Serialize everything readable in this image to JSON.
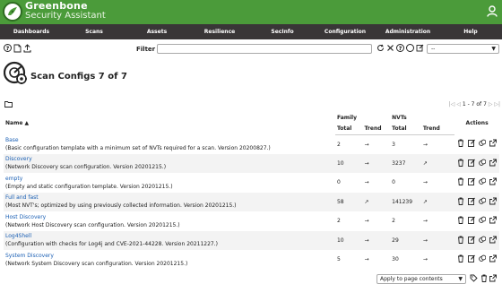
{
  "brand": {
    "line1": "Greenbone",
    "line2": "Security Assistant"
  },
  "nav": [
    "Dashboards",
    "Scans",
    "Assets",
    "Resilience",
    "SecInfo",
    "Configuration",
    "Administration",
    "Help"
  ],
  "filter": {
    "label": "Filter",
    "value": "",
    "select_value": "--"
  },
  "page": {
    "title": "Scan Configs 7 of 7"
  },
  "pager": {
    "text": "1 - 7 of 7"
  },
  "table": {
    "col_name": "Name ▲",
    "group_family": "Family",
    "group_nvts": "NVTs",
    "col_actions": "Actions",
    "sub_total": "Total",
    "sub_trend": "Trend",
    "sub_total2": "Total",
    "sub_trend2": "Trend",
    "rows": [
      {
        "name": "Base",
        "comment": "(Basic configuration template with a minimum set of NVTs required for a scan. Version 20200827.)",
        "family_total": "2",
        "family_trend": "→",
        "nvts_total": "3",
        "nvts_trend": "→"
      },
      {
        "name": "Discovery",
        "comment": "(Network Discovery scan configuration. Version 20201215.)",
        "family_total": "10",
        "family_trend": "→",
        "nvts_total": "3237",
        "nvts_trend": "↗"
      },
      {
        "name": "empty",
        "comment": "(Empty and static configuration template. Version 20201215.)",
        "family_total": "0",
        "family_trend": "→",
        "nvts_total": "0",
        "nvts_trend": "→"
      },
      {
        "name": "Full and fast",
        "comment": "(Most NVT's; optimized by using previously collected information. Version 20201215.)",
        "family_total": "58",
        "family_trend": "↗",
        "nvts_total": "141239",
        "nvts_trend": "↗"
      },
      {
        "name": "Host Discovery",
        "comment": "(Network Host Discovery scan configuration. Version 20201215.)",
        "family_total": "2",
        "family_trend": "→",
        "nvts_total": "2",
        "nvts_trend": "→"
      },
      {
        "name": "Log4Shell",
        "comment": "(Configuration with checks for Log4j and CVE-2021-44228. Version 20211227.)",
        "family_total": "10",
        "family_trend": "→",
        "nvts_total": "29",
        "nvts_trend": "→"
      },
      {
        "name": "System Discovery",
        "comment": "(Network System Discovery scan configuration. Version 20201215.)",
        "family_total": "5",
        "family_trend": "→",
        "nvts_total": "30",
        "nvts_trend": "→"
      }
    ]
  },
  "bulk": {
    "label": "Apply to page contents"
  },
  "icons": {
    "help": "help-icon",
    "new": "new-icon",
    "upload": "upload-icon",
    "refresh": "refresh-icon",
    "reset": "reset-filter-icon",
    "help_filter": "filter-help-icon",
    "edit_filter": "edit-filter-icon",
    "delete": "trashcan-icon",
    "edit": "edit-icon",
    "clone": "clone-icon",
    "export": "export-icon"
  },
  "colors": {
    "brand_green": "#4b9b3a",
    "nav_bg": "#393637",
    "link": "#1a5fb4"
  }
}
